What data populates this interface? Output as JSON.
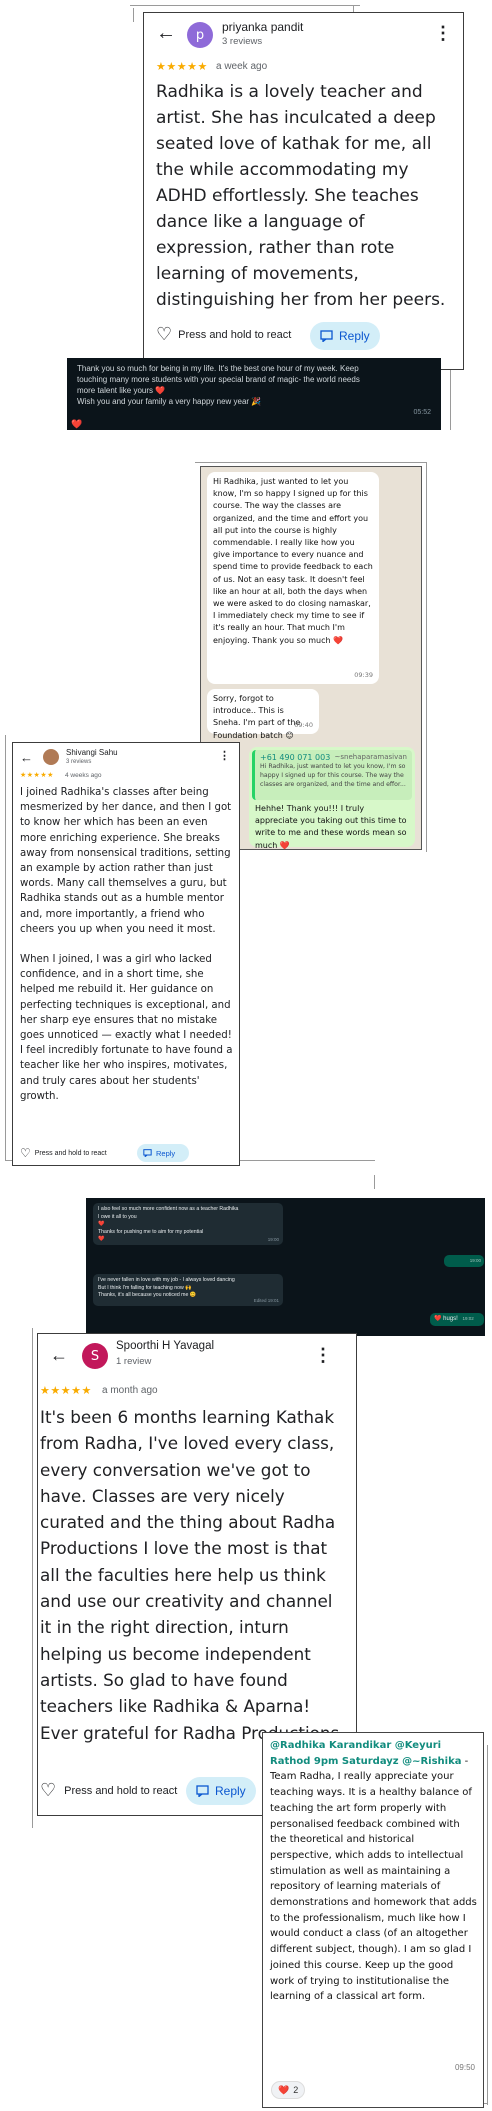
{
  "review1": {
    "avatar_letter": "p",
    "name": "priyanka pandit",
    "reviews": "3 reviews",
    "stars": "★★★★★",
    "when": "a week ago",
    "body": "Radhika is a lovely teacher and artist. She has inculcated a deep seated love of kathak for me, all the while accommodating my ADHD effortlessly. She teaches dance like a language of expression, rather than rote learning of movements, distinguishing her from her peers.",
    "react_label": "Press and hold to react",
    "reply_label": "Reply"
  },
  "dark_msg1": {
    "line1": "Thank you so much for being in my life. It's the best one hour of my week. Keep",
    "line2": "touching many more students with your special brand of magic- the world needs",
    "line3": "more talent like yours ❤️",
    "line4": "Wish you and your family a very happy new year 🎉",
    "time": "05:52",
    "reaction": "❤️"
  },
  "wa_chat1": {
    "msg1": "Hi Radhika, just wanted to let you know, I'm so happy I signed up for this course. The way the classes are organized, and the time and effort you all put into the course is highly commendable. I really like how you give importance to every nuance and spend time to provide feedback to each of us. Not an easy task. It doesn't feel like an hour at all, both the days when we were asked to do closing namaskar, I immediately check my time to see if it's really an hour. That much I'm enjoying. Thank you so much ❤️",
    "msg1_time": "09:39",
    "msg2": "Sorry, forgot to introduce.. This is Sneha. I'm part of the Foundation batch 😊",
    "msg2_time": "09:40",
    "quote_sender": "+61 490 071 003",
    "quote_name": "~snehaparamasivan",
    "quote_text": "Hi Radhika, just wanted to let you know, I'm so happy I signed up for this course. The way the classes are organized, and the time and effor...",
    "reply": "Hehhe! Thank you!!! I truly appreciate you taking out this time to write to me and these words mean so much ❤️"
  },
  "review2": {
    "name": "Shivangi Sahu",
    "reviews": "3 reviews",
    "stars": "★★★★★",
    "when": "4 weeks ago",
    "para1": "I joined Radhika's classes after being mesmerized by her dance, and then I got to know her which has been an even more enriching experience. She breaks away from nonsensical traditions, setting an example by action rather than just words. Many call themselves a guru, but Radhika stands out as a humble mentor and, more importantly, a friend who cheers you up when you need it most.",
    "para2": "When I joined, I was a girl who lacked confidence, and in a short time, she helped me rebuild it. Her guidance on perfecting techniques is exceptional, and her sharp eye ensures that no mistake goes unnoticed — exactly what I needed! I feel incredibly fortunate to have found a teacher like her who inspires, motivates, and truly cares about her students' growth.",
    "react_label": "Press and hold to react",
    "reply_label": "Reply"
  },
  "dark_chat2": {
    "m1_l1": "I also feel so much more confident now as a teacher Radhika",
    "m1_l2": "I owe it all to you",
    "m1_l3": "❤️",
    "m1_l4": "Thanks for pushing me to aim for my potential",
    "m1_l5": "❤️",
    "m1_time": "19:00",
    "m2_l1": "I've never fallen in love with my job - I always loved dancing",
    "m2_l2": "But I think I'm falling for teaching now 🙌",
    "m2_l3": "Thanks, it's all because you noticed me 😊",
    "m2_time": "Edited 19:01",
    "out1_time": "19:00",
    "out2_text": "❤️ hugs!",
    "out2_time": "19:02"
  },
  "review3": {
    "avatar_letter": "S",
    "name": "Spoorthi H Yavagal",
    "reviews": "1 review",
    "stars": "★★★★★",
    "when": "a month ago",
    "body": "It's been 6 months learning Kathak from Radha, I've loved every class, every conversation we've got to have. Classes are very nicely curated and the thing about Radha Productions I love the most is that all the faculties here help us think and use our creativity and channel it in the right direction, inturn helping us become independent artists. So glad to have found teachers like Radhika & Aparna! Ever grateful for Radha Productions.",
    "react_label": "Press and hold to react",
    "reply_label": "Reply"
  },
  "wa_msg3": {
    "mentions": "@Radhika Karandikar @Keyuri Rathod 9pm Saturdayz @~Rishika",
    "text": " - Team Radha, I really appreciate your teaching ways. It is a healthy balance of teaching the art form properly with personalised feedback combined with the theoretical and historical perspective, which adds to intellectual stimulation as well as maintaining a repository of learning materials of demonstrations and homework that adds to the professionalism, much like how I would conduct a class (of an altogether different subject, though). I am so glad I joined this course. Keep up the good work of trying to institutionalise the learning of a classical art form.",
    "time": "09:50",
    "reaction_emoji": "❤️",
    "reaction_count": "2"
  },
  "icons": {
    "back": "←",
    "kebab": "⋮",
    "heart_outline": "♡",
    "reply": "reply-icon"
  },
  "colors": {
    "avatar_purple": "#8e6ad8",
    "avatar_pink": "#c2185b",
    "star": "#f9ab00",
    "reply_bg": "#d3eef8",
    "reply_fg": "#0b57d0",
    "wa_mention": "#128c7e"
  }
}
